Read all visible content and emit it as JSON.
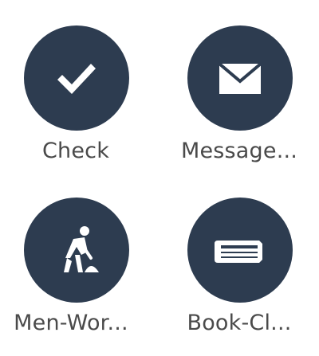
{
  "icon_grid": {
    "items": [
      {
        "label": "Check",
        "icon": "check-icon"
      },
      {
        "label": "Message...",
        "icon": "envelope-icon"
      },
      {
        "label": "Men-Wor...",
        "icon": "men-working-icon"
      },
      {
        "label": "Book-Cl...",
        "icon": "book-closed-icon"
      }
    ]
  },
  "colors": {
    "circle_fill": "#2d3c50",
    "icon_fill": "#ffffff",
    "label_text": "#4a4a4a"
  }
}
